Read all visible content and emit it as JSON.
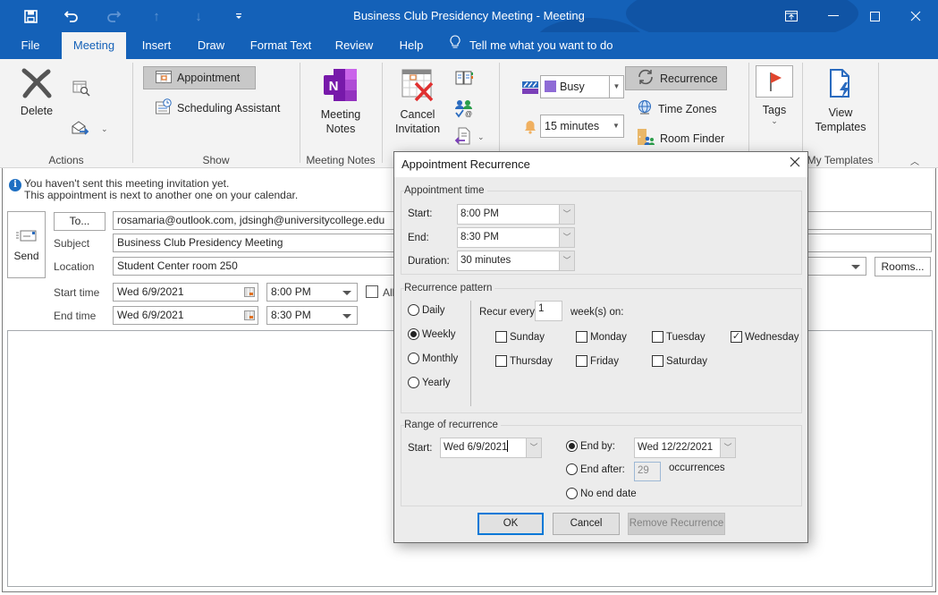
{
  "window": {
    "title": "Business Club Presidency Meeting  -  Meeting",
    "qat": [
      {
        "name": "save-icon",
        "glyph": "🖫"
      },
      {
        "name": "undo-icon",
        "glyph": "↶"
      },
      {
        "name": "redo-icon",
        "glyph": "↷"
      },
      {
        "name": "previous-item-icon",
        "glyph": "↑"
      },
      {
        "name": "next-item-icon",
        "glyph": "↓"
      },
      {
        "name": "customize-qat-icon",
        "glyph": "⩡"
      }
    ],
    "controls": {
      "ribbon_display": "⊡",
      "minimize": "—",
      "maximize": "☐",
      "close": "✕"
    }
  },
  "tabs": [
    {
      "label": "File"
    },
    {
      "label": "Meeting",
      "active": true
    },
    {
      "label": "Insert"
    },
    {
      "label": "Draw"
    },
    {
      "label": "Format Text"
    },
    {
      "label": "Review"
    },
    {
      "label": "Help"
    }
  ],
  "tell_me": {
    "placeholder": "Tell me what you want to do",
    "icon": "lightbulb-icon"
  },
  "ribbon": {
    "groups": {
      "actions": "Actions",
      "show": "Show",
      "meeting_notes": "Meeting Notes",
      "my_templates": "My Templates"
    },
    "delete": "Delete",
    "appointment": "Appointment",
    "scheduling_assistant": "Scheduling Assistant",
    "meeting_notes_btn": [
      "Meeting",
      "Notes"
    ],
    "cancel_invitation": [
      "Cancel",
      "Invitation"
    ],
    "show_as": {
      "value": "Busy",
      "color": "#8e6bd6"
    },
    "reminder": {
      "value": "15 minutes"
    },
    "recurrence": "Recurrence",
    "time_zones": "Time Zones",
    "room_finder": "Room Finder",
    "tags": "Tags",
    "view_templates": [
      "View",
      "Templates"
    ]
  },
  "info": {
    "line1": "You haven't sent this meeting invitation yet.",
    "line2": "This appointment is next to another one on your calendar."
  },
  "form": {
    "send": "Send",
    "to_button": "To...",
    "to_value": "rosamaria@outlook.com, jdsingh@universitycollege.edu",
    "subject_label": "Subject",
    "subject_value": "Business Club Presidency Meeting",
    "location_label": "Location",
    "location_value": "Student Center room 250",
    "rooms_button": "Rooms...",
    "start_label": "Start time",
    "start_date": "Wed 6/9/2021",
    "start_time": "8:00 PM",
    "end_label": "End time",
    "end_date": "Wed 6/9/2021",
    "end_time": "8:30 PM",
    "all_day_label": "All",
    "all_day_checked": false
  },
  "dialog": {
    "title": "Appointment Recurrence",
    "appointment_time": {
      "legend": "Appointment time",
      "start_label": "Start:",
      "start_value": "8:00 PM",
      "end_label": "End:",
      "end_value": "8:30 PM",
      "duration_label": "Duration:",
      "duration_value": "30 minutes"
    },
    "pattern": {
      "legend": "Recurrence pattern",
      "options": [
        {
          "label": "Daily",
          "selected": false
        },
        {
          "label": "Weekly",
          "selected": true
        },
        {
          "label": "Monthly",
          "selected": false
        },
        {
          "label": "Yearly",
          "selected": false
        }
      ],
      "recur_every_label": "Recur every",
      "recur_every_value": "1",
      "weeks_on_label": "week(s) on:",
      "days": [
        {
          "label": "Sunday",
          "checked": false
        },
        {
          "label": "Monday",
          "checked": false
        },
        {
          "label": "Tuesday",
          "checked": false
        },
        {
          "label": "Wednesday",
          "checked": true
        },
        {
          "label": "Thursday",
          "checked": false
        },
        {
          "label": "Friday",
          "checked": false
        },
        {
          "label": "Saturday",
          "checked": false
        }
      ]
    },
    "range": {
      "legend": "Range of recurrence",
      "start_label": "Start:",
      "start_value": "Wed 6/9/2021",
      "end_by_label": "End by:",
      "end_by_value": "Wed 12/22/2021",
      "end_by_selected": true,
      "end_after_label": "End after:",
      "end_after_value": "29",
      "end_after_selected": false,
      "occurrences_label": "occurrences",
      "no_end_label": "No end date",
      "no_end_selected": false
    },
    "buttons": {
      "ok": "OK",
      "cancel": "Cancel",
      "remove": "Remove Recurrence"
    }
  }
}
